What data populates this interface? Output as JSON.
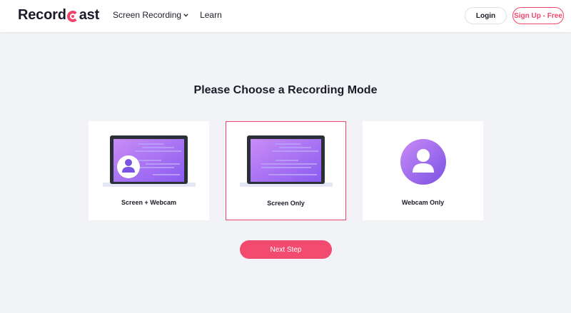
{
  "header": {
    "logo_text": {
      "before": "Record",
      "after": "ast"
    },
    "nav": {
      "screen_recording_label": "Screen Recording",
      "learn_label": "Learn"
    },
    "login_label": "Login",
    "signup_label": "Sign Up - Free"
  },
  "main": {
    "title": "Please Choose a Recording Mode",
    "modes": [
      {
        "label": "Screen + Webcam",
        "icon": "laptop-with-avatar-icon",
        "selected": false
      },
      {
        "label": "Screen Only",
        "icon": "laptop-icon",
        "selected": true
      },
      {
        "label": "Webcam Only",
        "icon": "user-avatar-icon",
        "selected": false
      }
    ],
    "next_step_label": "Next Step"
  },
  "colors": {
    "accent": "#f0456b",
    "screen_gradient_start": "#c98bf6",
    "screen_gradient_end": "#8a5cf0",
    "background": "#f2f3f7"
  }
}
